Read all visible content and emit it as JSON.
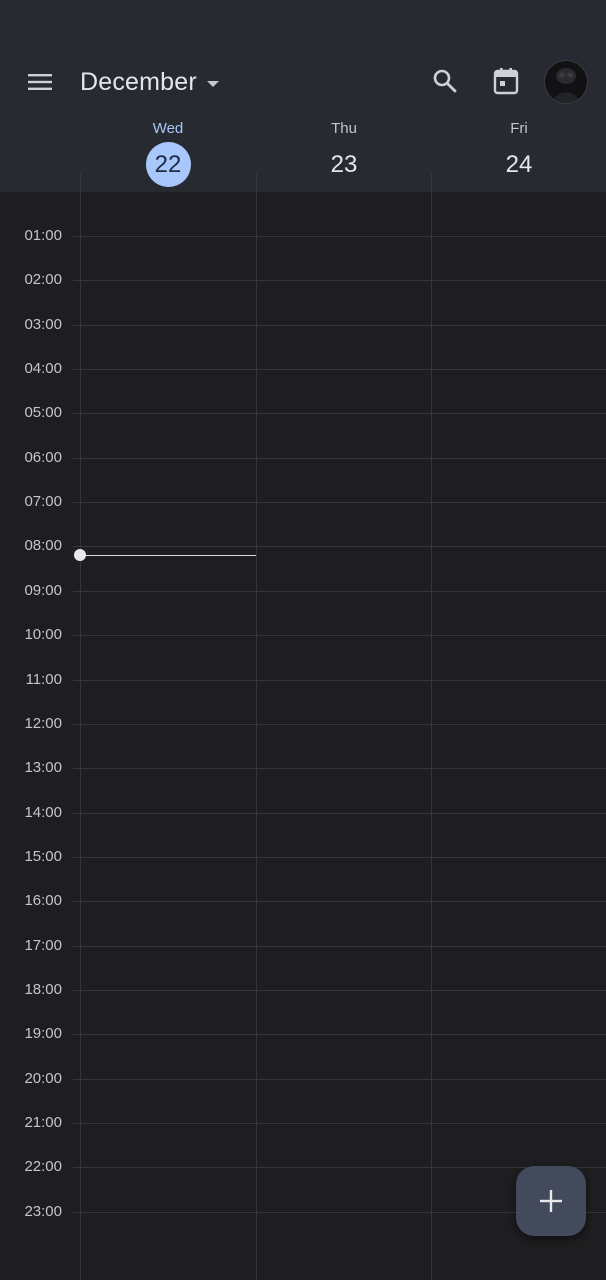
{
  "header": {
    "month_label": "December",
    "icons": {
      "menu": "menu-icon",
      "dropdown": "caret-down-icon",
      "search": "search-icon",
      "today": "calendar-today-icon",
      "avatar": "avatar"
    }
  },
  "days": [
    {
      "name": "Wed",
      "number": "22",
      "is_today": true
    },
    {
      "name": "Thu",
      "number": "23",
      "is_today": false
    },
    {
      "name": "Fri",
      "number": "24",
      "is_today": false
    }
  ],
  "hours": [
    "01:00",
    "02:00",
    "03:00",
    "04:00",
    "05:00",
    "06:00",
    "07:00",
    "08:00",
    "09:00",
    "10:00",
    "11:00",
    "12:00",
    "13:00",
    "14:00",
    "15:00",
    "16:00",
    "17:00",
    "18:00",
    "19:00",
    "20:00",
    "21:00",
    "22:00",
    "23:00"
  ],
  "current_time_indicator": {
    "day": "Wed",
    "time_fraction_of_day": 0.3417
  },
  "fab": {
    "icon": "plus-icon"
  },
  "colors": {
    "header_bg": "#272a31",
    "grid_bg": "#1e1e20",
    "today_accent": "#a8c7fa",
    "fab_bg": "#424a5c"
  }
}
